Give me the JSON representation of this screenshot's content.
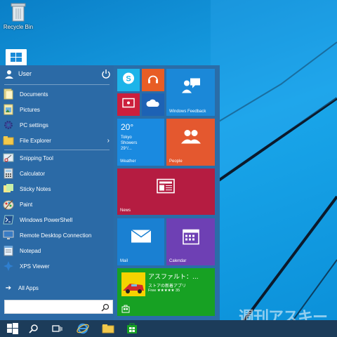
{
  "desktop": {
    "recycle_bin_label": "Recycle Bin"
  },
  "start_menu": {
    "user_name": "User",
    "items": [
      {
        "label": "Documents",
        "icon": "documents-icon"
      },
      {
        "label": "Pictures",
        "icon": "pictures-icon"
      },
      {
        "label": "PC settings",
        "icon": "gear-icon"
      },
      {
        "label": "File Explorer",
        "icon": "folder-icon",
        "has_submenu": true
      }
    ],
    "apps": [
      {
        "label": "Snipping Tool",
        "icon": "scissors-icon"
      },
      {
        "label": "Calculator",
        "icon": "calculator-icon"
      },
      {
        "label": "Sticky Notes",
        "icon": "sticky-notes-icon"
      },
      {
        "label": "Paint",
        "icon": "paint-icon"
      },
      {
        "label": "Windows PowerShell",
        "icon": "powershell-icon"
      },
      {
        "label": "Remote Desktop Connection",
        "icon": "remote-desktop-icon"
      },
      {
        "label": "Notepad",
        "icon": "notepad-icon"
      },
      {
        "label": "XPS Viewer",
        "icon": "xps-viewer-icon"
      }
    ],
    "all_apps_label": "All Apps",
    "search_value": "",
    "chevron": "›"
  },
  "tiles": {
    "windows_feedback": "Windows Feedback",
    "weather": {
      "label": "Weather",
      "temp": "20°",
      "city": "Tokyo",
      "condition": "Showers",
      "range": "29°/..."
    },
    "people": "People",
    "news": "News",
    "mail": "Mail",
    "calendar": "Calendar",
    "store": {
      "title": "アスファルト：...",
      "subtitle": "ストアの新着アプリ",
      "price": "Free ★★★★★ 35"
    }
  },
  "watermark": "週刊アスキー",
  "colors": {
    "start_bg": "#2a6da8",
    "taskbar_bg": "#1c3c5a",
    "desktop": "#0a8fd8"
  }
}
